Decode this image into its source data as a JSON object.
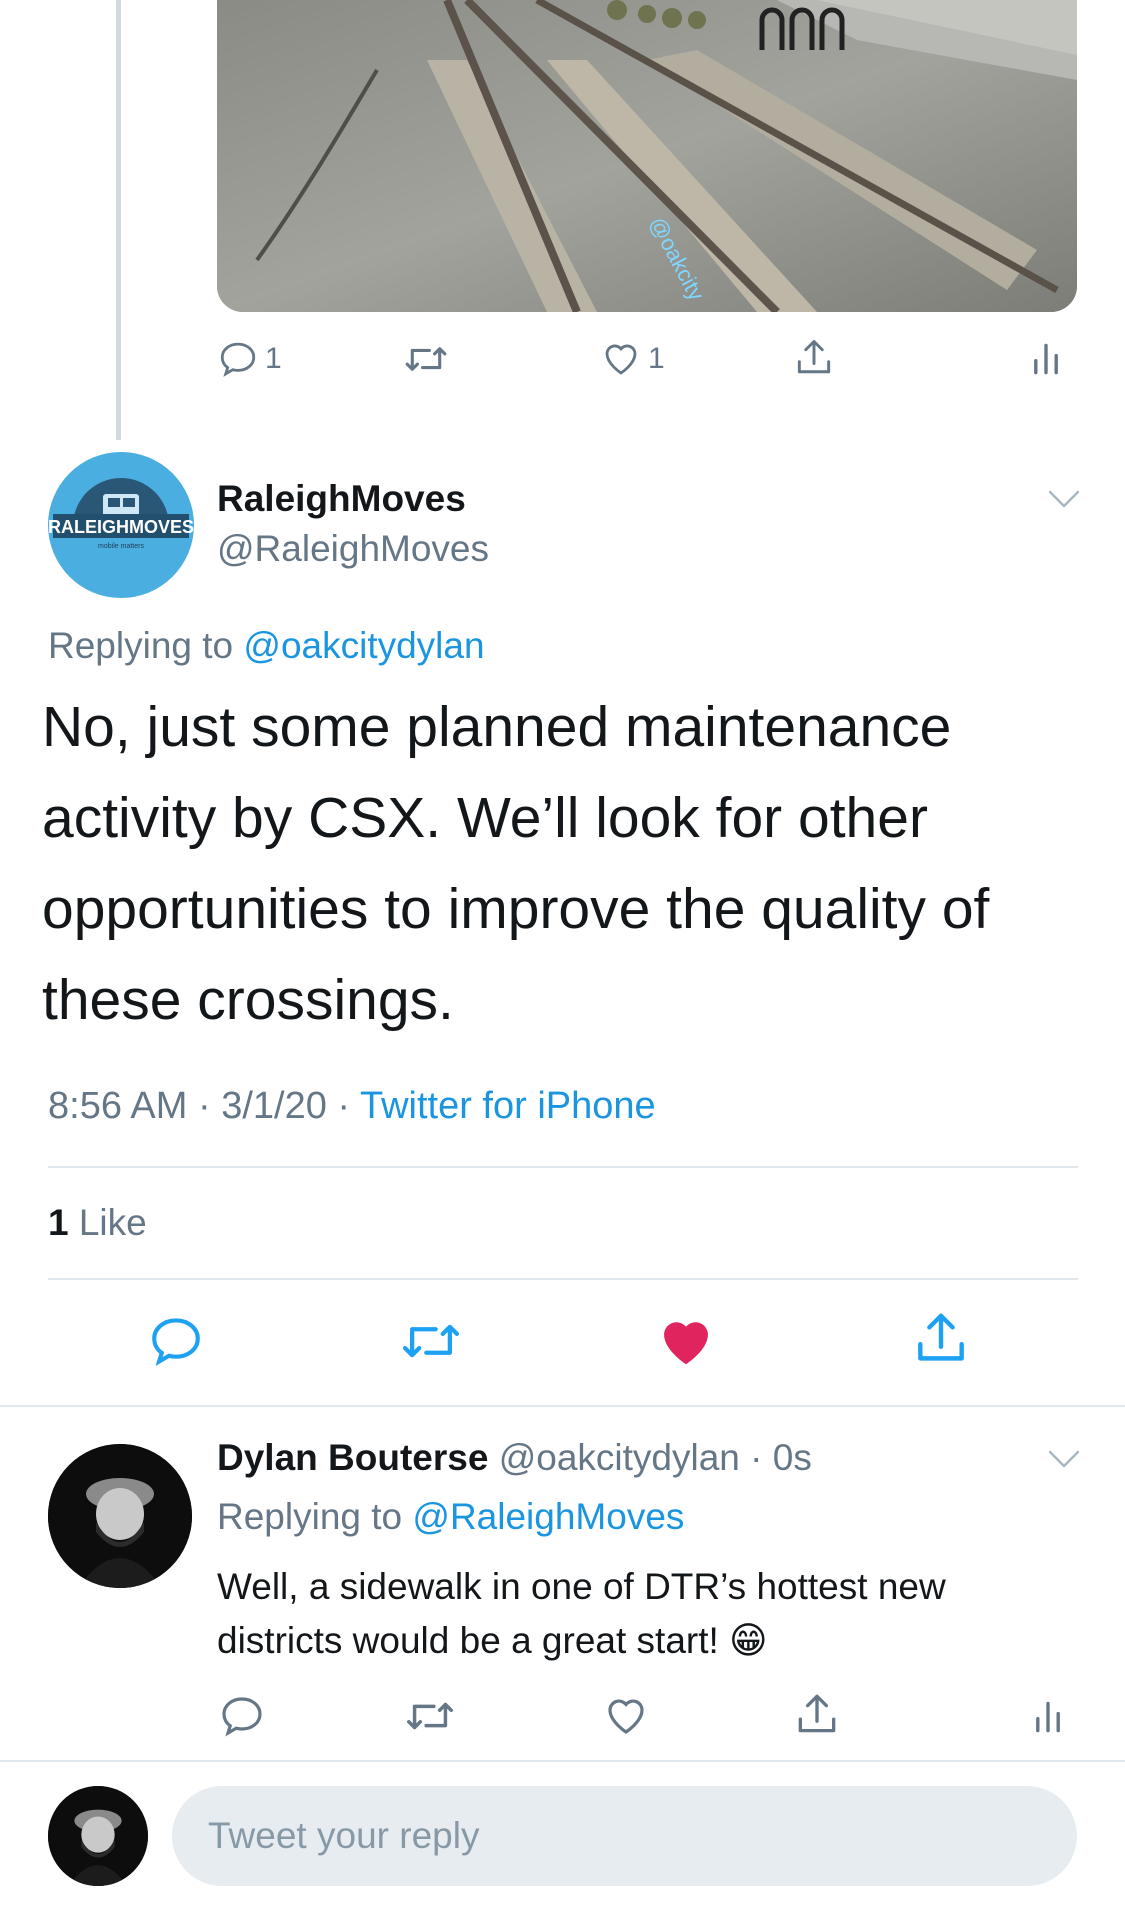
{
  "top_tweet": {
    "photo_watermark": "@oakcity",
    "actions": {
      "reply_count": "1",
      "retweet_count": "",
      "like_count": "1"
    }
  },
  "main_tweet": {
    "avatar_text": "RALEIGHMOVES",
    "avatar_subtext": "mobile matters",
    "display_name": "RaleighMoves",
    "handle": "@RaleighMoves",
    "replying_label": "Replying to ",
    "replying_to": "@oakcitydylan",
    "text": "No, just some planned maintenance activity by CSX. We’ll look for other opportunities to improve the quality of these crossings.",
    "time": "8:56 AM",
    "sep1": " · ",
    "date": "3/1/20",
    "sep2": " · ",
    "source": "Twitter for iPhone",
    "likes_count": "1",
    "likes_label": " Like",
    "colors": {
      "liked": "#e0245e",
      "link": "#1b95e0"
    }
  },
  "reply_tweet": {
    "display_name": "Dylan Bouterse",
    "handle": "@oakcitydylan",
    "time": " · 0s",
    "replying_label": "Replying to ",
    "replying_to": "@RaleighMoves",
    "text": "Well, a sidewalk in one of DTR’s hottest new districts would be a great start! 😁"
  },
  "composer": {
    "placeholder": "Tweet your reply"
  }
}
